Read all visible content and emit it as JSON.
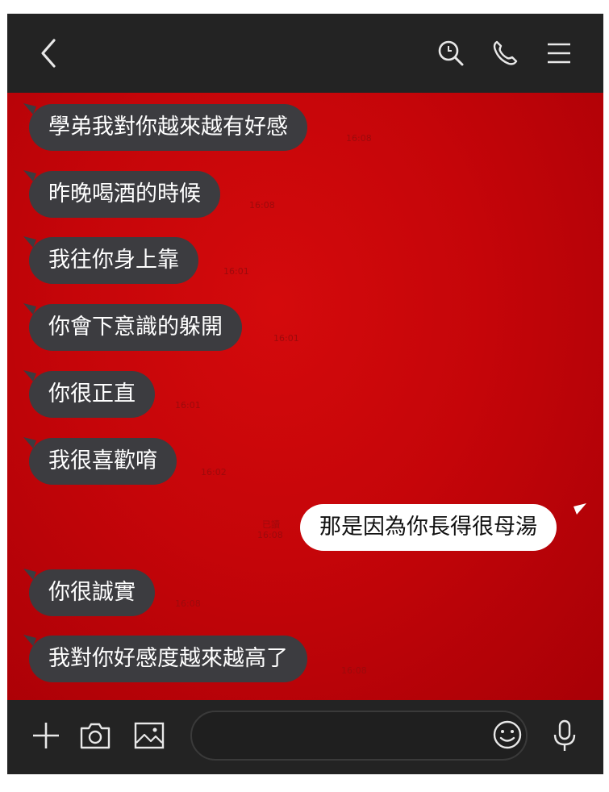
{
  "header": {
    "icons": [
      "back-arrow-icon",
      "search-icon",
      "phone-icon",
      "menu-icon"
    ]
  },
  "messages": [
    {
      "dir": "in",
      "text": "學弟我對你越來越有好感",
      "time": "16:08"
    },
    {
      "dir": "in",
      "text": "昨晚喝酒的時候",
      "time": "16:08"
    },
    {
      "dir": "in",
      "text": "我往你身上靠",
      "time": "16:01"
    },
    {
      "dir": "in",
      "text": "你會下意識的躲開",
      "time": "16:01"
    },
    {
      "dir": "in",
      "text": "你很正直",
      "time": "16:01"
    },
    {
      "dir": "in",
      "text": "我很喜歡唷",
      "time": "16:02"
    },
    {
      "dir": "out",
      "text": "那是因為你長得很母湯",
      "read": "已讀",
      "time": "16:08"
    },
    {
      "dir": "in",
      "text": "你很誠實",
      "time": "16:08"
    },
    {
      "dir": "in",
      "text": "我對你好感度越來越高了",
      "time": "16:08"
    }
  ],
  "input": {
    "placeholder": ""
  },
  "colors": {
    "background_red": "#c50509",
    "bar": "#232323",
    "incoming_bubble": "#3c3c40",
    "outgoing_bubble": "#ffffff"
  }
}
